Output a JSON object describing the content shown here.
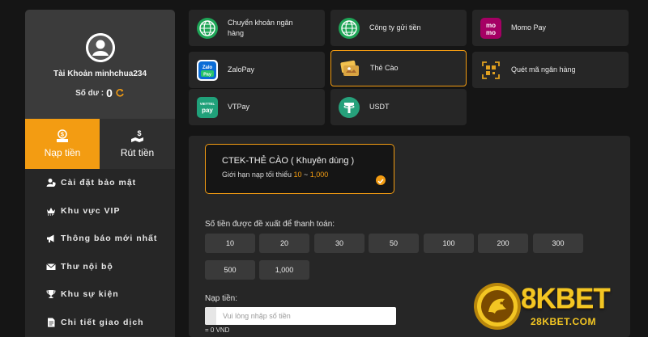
{
  "profile": {
    "username": "Tài Khoản minhchua234",
    "balance_label": "Số dư :",
    "balance_value": "0"
  },
  "tabs": {
    "deposit": "Nạp tiền",
    "withdraw": "Rút tiền"
  },
  "menu": [
    {
      "label": "Cài đặt bảo mật",
      "icon": "user-shield-icon"
    },
    {
      "label": "Khu vực VIP",
      "icon": "vip-crown-icon"
    },
    {
      "label": "Thông báo mới nhất",
      "icon": "megaphone-icon"
    },
    {
      "label": "Thư nội bộ",
      "icon": "mail-icon"
    },
    {
      "label": "Khu sự kiện",
      "icon": "trophy-icon"
    },
    {
      "label": "Chi tiết giao dịch",
      "icon": "document-icon"
    }
  ],
  "methods": [
    {
      "label": "Chuyển khoản ngân hàng",
      "icon": "globe-icon"
    },
    {
      "label": "Công ty gửi tiền",
      "icon": "globe-icon"
    },
    {
      "label": "Momo Pay",
      "icon": "momo-icon"
    },
    {
      "label": "ZaloPay",
      "icon": "zalopay-icon"
    },
    {
      "label": "Thẻ Cào",
      "icon": "scratch-card-icon"
    },
    {
      "label": "Quét mã ngân hàng",
      "icon": "qr-scan-icon"
    },
    {
      "label": "VTPay",
      "icon": "vtpay-icon"
    },
    {
      "label": "USDT",
      "icon": "tether-icon"
    }
  ],
  "channel": {
    "title": "CTEK-THẺ CÀO ( Khuyên dùng )",
    "limit_prefix": "Giới hạn nạp tối thiểu ",
    "limit_min": "10",
    "limit_sep": " ~ ",
    "limit_max": "1,000"
  },
  "suggest_label": "Số tiền được đề xuất để thanh toán:",
  "amounts": [
    "10",
    "20",
    "30",
    "50",
    "100",
    "200",
    "300",
    "500",
    "1,000"
  ],
  "deposit_input": {
    "label": "Nạp tiền:",
    "placeholder": "Vui lòng nhập số tiền",
    "readout": "= 0 VND"
  },
  "logo": {
    "text": "8KBET",
    "url": "28KBET.COM"
  },
  "colors": {
    "accent": "#f39c12",
    "background": "#151515",
    "panel": "#262626",
    "logo_gold": "#f3c623"
  }
}
